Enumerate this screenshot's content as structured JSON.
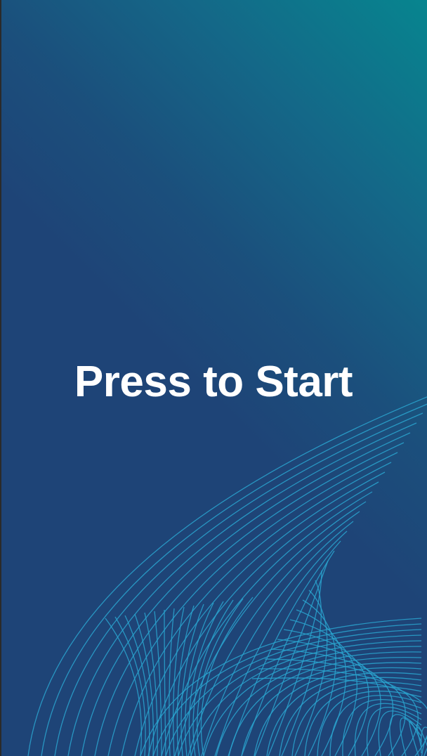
{
  "start_screen": {
    "label": "Press to Start"
  },
  "colors": {
    "background_base": "#1e4477",
    "background_accent": "#07858f",
    "line_color": "#2aa5cf",
    "text": "#ffffff"
  },
  "decoration": {
    "icon": "wave-lines-pattern"
  }
}
